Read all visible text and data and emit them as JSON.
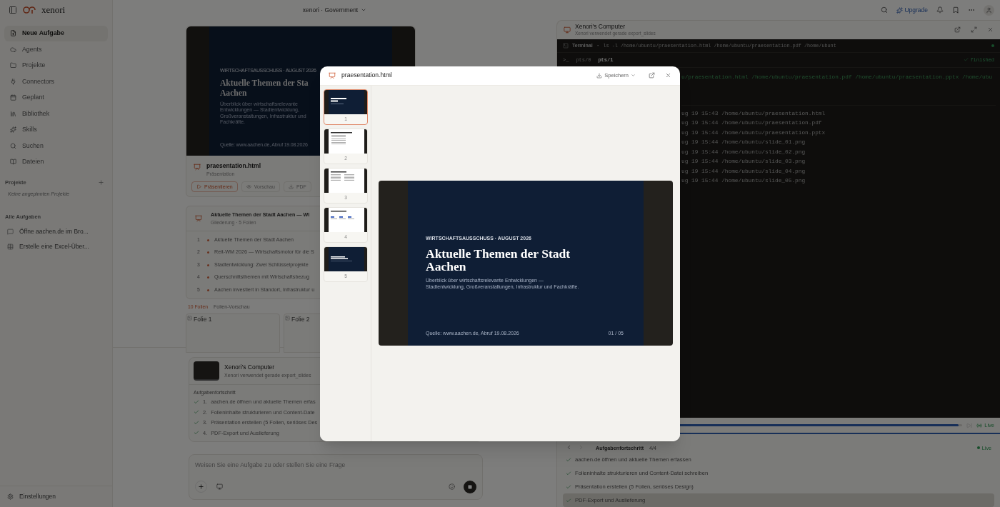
{
  "header": {
    "brand": "xenori",
    "workspace": "xenori · Government",
    "upgrade": "Upgrade"
  },
  "sidebar": {
    "items": [
      {
        "label": "Neue Aufgabe",
        "selected": true
      },
      {
        "label": "Agents",
        "selected": false
      },
      {
        "label": "Projekte",
        "selected": false
      },
      {
        "label": "Connectors",
        "selected": false
      },
      {
        "label": "Geplant",
        "selected": false
      },
      {
        "label": "Bibliothek",
        "selected": false
      },
      {
        "label": "Skills",
        "selected": false
      },
      {
        "label": "Suchen",
        "selected": false
      },
      {
        "label": "Dateien",
        "selected": false
      }
    ],
    "projects": {
      "heading": "Projekte",
      "empty": "Keine angepinnten Projekte"
    },
    "tasks": {
      "heading": "Alle Aufgaben",
      "items": [
        {
          "label": "Öffne aachen.de im Bro...",
          "kind": "chat"
        },
        {
          "label": "Erstelle eine Excel-Über...",
          "kind": "table"
        }
      ]
    },
    "settings": "Einstellungen"
  },
  "chat": {
    "preview": {
      "kicker": "WIRTSCHAFTSAUSSCHUSS · AUGUST 2026",
      "title_lines": [
        "Aktuelle Themen der Sta",
        "Aachen"
      ],
      "subtitle": "Überblick über wirtschaftsrelevante Entwicklungen — Stadtentwicklung, Großveranstaltungen, Infrastruktur und Fachkräfte.",
      "source": "Quelle: www.aachen.de, Abruf 19.08.2026"
    },
    "file": {
      "name": "praesentation.html",
      "type": "Präsentation",
      "actions": [
        {
          "label": "Präsentieren",
          "kind": "present"
        },
        {
          "label": "Vorschau",
          "kind": "preview"
        },
        {
          "label": "PDF",
          "kind": "download"
        }
      ]
    },
    "outline": {
      "title": "Aktuelle Themen der Stadt Aachen — Wi",
      "meta": "Gliederung · 5 Folien",
      "items": [
        {
          "number": "1",
          "label": "Aktuelle Themen der Stadt Aachen"
        },
        {
          "number": "2",
          "label": "Reit-WM 2026 — Wirtschaftsmotor für die S"
        },
        {
          "number": "3",
          "label": "Stadtentwicklung: Zwei Schlüsselprojekte"
        },
        {
          "number": "4",
          "label": "Querschnittsthemen mit Wirtschaftsbezug"
        },
        {
          "number": "5",
          "label": "Aachen investiert in Standort, Infrastruktur u"
        }
      ]
    },
    "gallery": {
      "count": "10 Folien",
      "label": "Folien-Vorschau",
      "images": [
        "Folie 1",
        "Folie 2"
      ]
    },
    "computer": {
      "title": "Xenori's Computer",
      "status": "Xenori verwendet gerade export_slides",
      "heading": "Aufgabenfortschritt",
      "steps": [
        {
          "number": "1.",
          "label": "aachen.de öffnen und aktuelle Themen erfas",
          "done": true
        },
        {
          "number": "2.",
          "label": "Folieninhalte strukturieren und Content-Date",
          "done": true
        },
        {
          "number": "3.",
          "label": "Präsentation erstellen (5 Folien, seriöses Des",
          "done": true
        },
        {
          "number": "4.",
          "label": "PDF-Export und Auslieferung",
          "done": true
        }
      ]
    },
    "composer": {
      "placeholder": "Weisen Sie eine Aufgabe zu oder stellen Sie eine Frage"
    }
  },
  "computer_panel": {
    "title": "Xenori's Computer",
    "status": "Xenori verwendet gerade export_slides",
    "terminal": {
      "tab": "Terminal",
      "separator": "·",
      "prompt": ">_",
      "command": "ls -l /home/ubuntu/praesentation.html /home/ubuntu/praesentation.pdf /home/ubunt",
      "sessions": [
        {
          "label": "pts/0",
          "selected": false
        },
        {
          "label": "pts/1",
          "selected": true
        }
      ],
      "state": "finished",
      "command_tail": "u/praesentation.html /home/ubuntu/praesentation.pdf /home/ubuntu/praesentation.pptx /home/ubu",
      "output": [
        "ug 19 15:43 /home/ubuntu/praesentation.html",
        "ug 19 15:44 /home/ubuntu/praesentation.pdf",
        "ug 19 15:44 /home/ubuntu/praesentation.pptx",
        "ug 19 15:44 /home/ubuntu/slide_01.png",
        "ug 19 15:44 /home/ubuntu/slide_02.png",
        "ug 19 15:44 /home/ubuntu/slide_03.png",
        "ug 19 15:44 /home/ubuntu/slide_04.png",
        "ug 19 15:44 /home/ubuntu/slide_05.png"
      ]
    },
    "timeline": {
      "level": 0.99,
      "live": "Live"
    },
    "progress": {
      "heading": "Aufgabenfortschritt",
      "count": "4/4",
      "live": "Live",
      "steps": [
        {
          "label": "aachen.de öffnen und aktuelle Themen erfassen",
          "done": true,
          "selected": false
        },
        {
          "label": "Folieninhalte strukturieren und Content-Datei schreiben",
          "done": true,
          "selected": false
        },
        {
          "label": "Präsentation erstellen (5 Folien, seriöses Design)",
          "done": true,
          "selected": false
        },
        {
          "label": "PDF-Export und Auslieferung",
          "done": true,
          "selected": true
        }
      ]
    }
  },
  "modal": {
    "title": "praesentation.html",
    "save": "Speichern",
    "slides": [
      {
        "number": "1",
        "selected": true,
        "kind": "title"
      },
      {
        "number": "2",
        "selected": false,
        "kind": "bullets"
      },
      {
        "number": "3",
        "selected": false,
        "kind": "columns"
      },
      {
        "number": "4",
        "selected": false,
        "kind": "stats"
      },
      {
        "number": "5",
        "selected": false,
        "kind": "closing"
      }
    ],
    "slide": {
      "kicker": "WIRTSCHAFTSAUSSCHUSS · AUGUST 2026",
      "title": "Aktuelle Themen der Stadt Aachen",
      "subtitle": "Überblick über wirtschaftsrelevante Entwicklungen — Stadtentwicklung, Großveranstaltungen, Infrastruktur und Fachkräfte.",
      "source": "Quelle: www.aachen.de, Abruf 19.08.2026",
      "page": "01 / 05"
    }
  }
}
